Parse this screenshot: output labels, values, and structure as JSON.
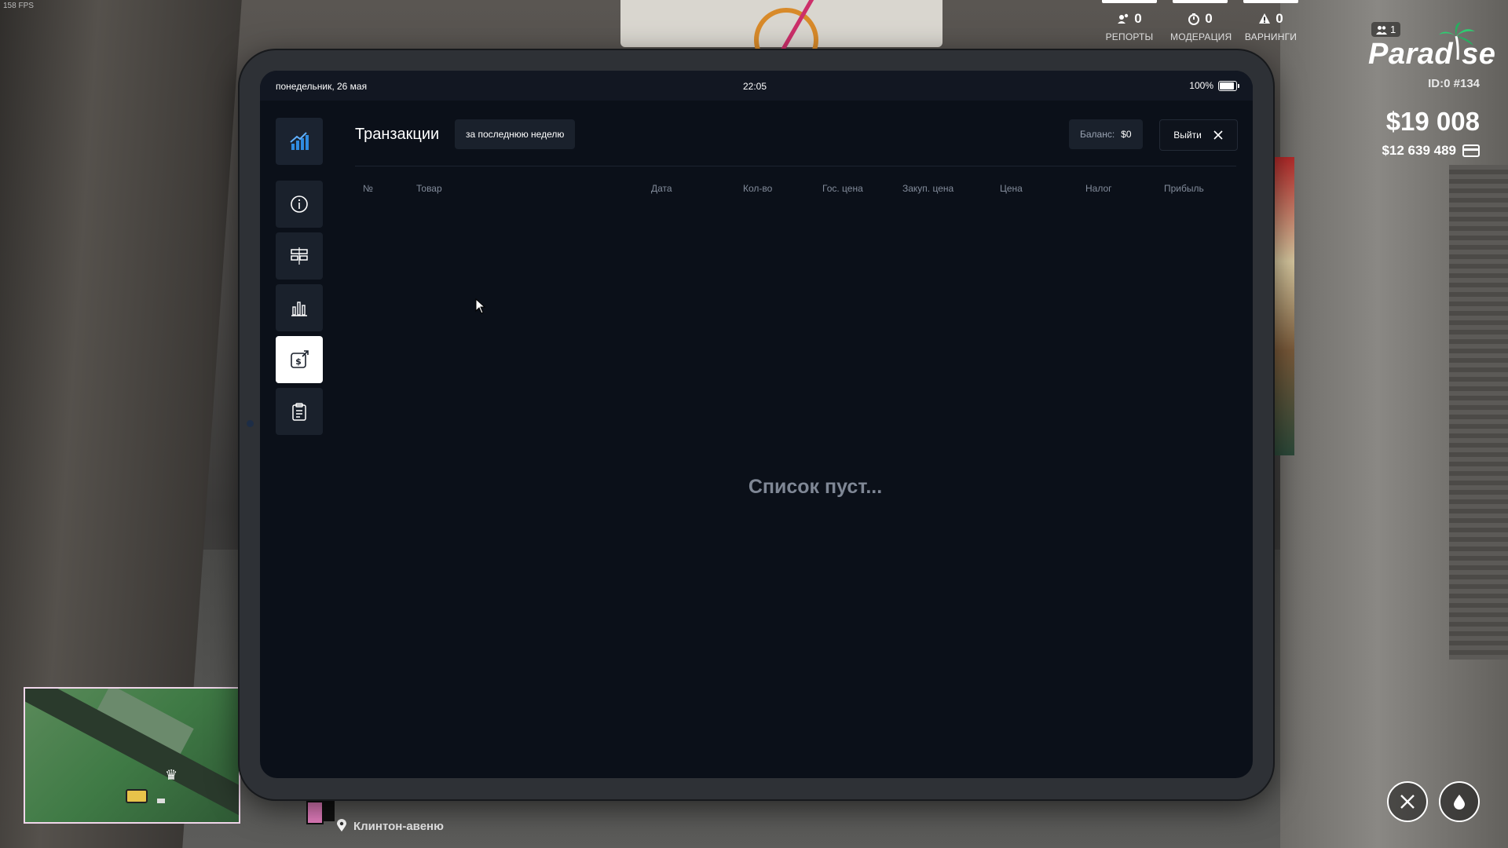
{
  "hud": {
    "fps": "158 FPS",
    "stats": [
      {
        "icon": "reports-icon",
        "value": "0",
        "label": "РЕПОРТЫ"
      },
      {
        "icon": "moderation-icon",
        "value": "0",
        "label": "МОДЕРАЦИЯ"
      },
      {
        "icon": "warning-icon",
        "value": "0",
        "label": "ВАРНИНГИ"
      }
    ],
    "online_count": "1",
    "logo": "Parad se",
    "player_id": "ID:0 #134",
    "cash": "$19 008",
    "bank": "$12 639 489",
    "street": "Клинтон-авеню"
  },
  "tablet": {
    "status_bar": {
      "date": "понедельник, 26 мая",
      "time": "22:05",
      "battery": "100%"
    },
    "sidebar": [
      {
        "name": "info",
        "icon": "info-icon",
        "active": false
      },
      {
        "name": "goods",
        "icon": "grid-list-icon",
        "active": false
      },
      {
        "name": "stats",
        "icon": "bar-chart-icon",
        "active": false
      },
      {
        "name": "transactions",
        "icon": "money-exchange-icon",
        "active": true
      },
      {
        "name": "orders",
        "icon": "clipboard-icon",
        "active": false
      }
    ],
    "title": "Транзакции",
    "period": "за последнюю неделю",
    "balance_label": "Баланс:",
    "balance_value": "$0",
    "exit_label": "Выйти",
    "table_headers": [
      "№",
      "Товар",
      "Дата",
      "Кол-во",
      "Гос. цена",
      "Закуп. цена",
      "Цена",
      "Налог",
      "Прибыль"
    ],
    "rows": [],
    "empty_text": "Список пуст..."
  },
  "colors": {
    "screen_bg": "#0b1019",
    "panel": "#1a212c",
    "muted_text": "#838c9b",
    "accent_blue": "#2f8be0"
  }
}
